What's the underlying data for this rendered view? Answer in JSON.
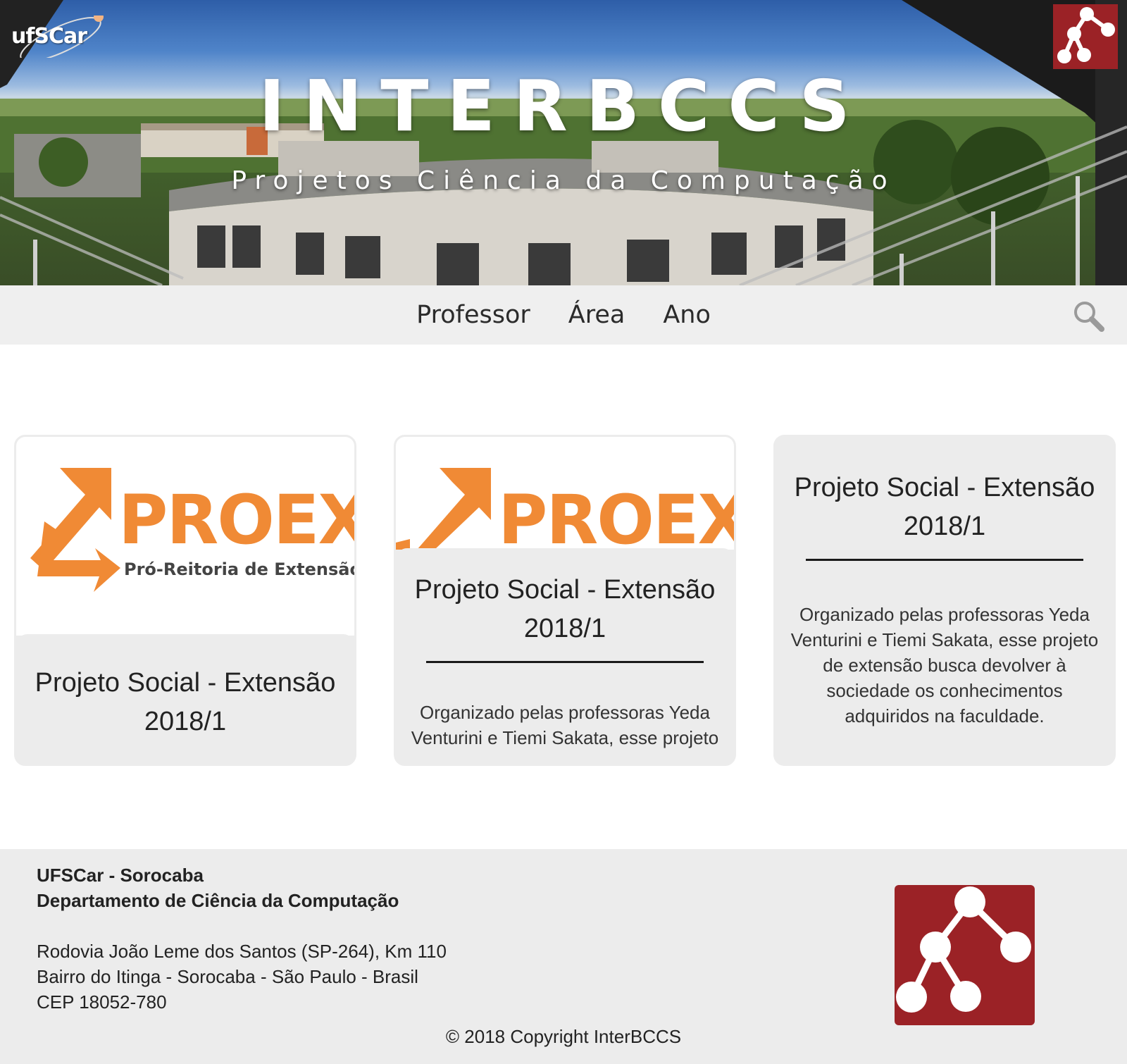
{
  "header": {
    "logo_text": "ufSCar",
    "title": "INTERBCCS",
    "subtitle": "Projetos Ciência da Computação"
  },
  "nav": {
    "items": [
      {
        "label": "Professor"
      },
      {
        "label": "Área"
      },
      {
        "label": "Ano"
      }
    ]
  },
  "cards": [
    {
      "logo_word": "PROEX",
      "logo_sub": "Pró-Reitoria de Extensão",
      "title_line1": "Projeto Social - Extensão",
      "title_line2": "2018/1"
    },
    {
      "logo_word": "PROEX",
      "title_line1": "Projeto Social - Extensão",
      "title_line2": "2018/1",
      "description": "Organizado pelas professoras Yeda Venturini e Tiemi Sakata, esse projeto"
    },
    {
      "title_line1": "Projeto Social - Extensão",
      "title_line2": "2018/1",
      "description": "Organizado pelas professoras Yeda Venturini e Tiemi Sakata, esse projeto de extensão busca devolver à sociedade os conhecimentos adquiridos na faculdade."
    }
  ],
  "footer": {
    "org": "UFSCar - Sorocaba",
    "dept": "Departamento de Ciência da Computação",
    "address_line1": "Rodovia João Leme dos Santos (SP-264), Km 110",
    "address_line2": "Bairro do Itinga - Sorocaba - São Paulo - Brasil",
    "address_line3": "CEP 18052-780",
    "copyright": "© 2018 Copyright InterBCCS"
  },
  "colors": {
    "brand_red": "#9b2226",
    "proex_orange": "#f08a35",
    "nav_bg": "#efefef",
    "card_bg": "#ececec"
  },
  "icons": {
    "search": "search-icon",
    "tree_logo": "tree-graph-icon"
  }
}
